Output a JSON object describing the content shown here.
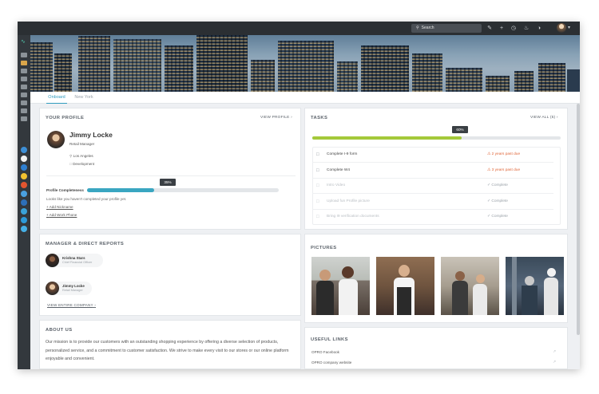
{
  "topbar": {
    "search_placeholder": "Search",
    "icons": [
      "pencil-icon",
      "plus-icon",
      "clock-icon",
      "bell-icon",
      "moon-icon"
    ]
  },
  "tabs": [
    {
      "label": "Onboard",
      "active": true
    },
    {
      "label": "New York",
      "active": false
    }
  ],
  "profile": {
    "section_title": "YOUR PROFILE",
    "view_link": "VIEW PROFILE",
    "name": "Jimmy Locke",
    "role": "Retail Manager",
    "location": "Los Angeles",
    "department": "Development",
    "completeness_label": "Profile Completeness",
    "completeness_value": 35,
    "completeness_text": "35%",
    "hint": "Looks like you haven't completed your profile yet.",
    "add_nickname": "Add Nickname",
    "add_work_phone": "Add Work Phone"
  },
  "reports": {
    "section_title": "MANAGER & DIRECT REPORTS",
    "people": [
      {
        "name": "Krishna Stars",
        "title": "Chief Financial Officer"
      },
      {
        "name": "Jimmy Locke",
        "title": "Retail Manager"
      }
    ],
    "view_link": "VIEW ENTIRE COMPANY"
  },
  "about": {
    "section_title": "ABOUT US",
    "text": "Our mission is to provide our customers with an outstanding shopping experience by offering a diverse selection of products, personalized service, and a commitment to customer satisfaction. We strive to make every visit to our stores or our online platform enjoyable and convenient."
  },
  "tasks": {
    "section_title": "TASKS",
    "view_all": "VIEW ALL (5)",
    "progress_value": 60,
    "progress_text": "60%",
    "items": [
      {
        "label": "Complete I-9 form",
        "status": "2 years past due",
        "state": "overdue"
      },
      {
        "label": "Complete W4",
        "status": "3 years past due",
        "state": "overdue"
      },
      {
        "label": "Intro Video",
        "status": "Complete",
        "state": "complete"
      },
      {
        "label": "Upload fun Profile picture",
        "status": "Complete",
        "state": "complete"
      },
      {
        "label": "Bring I9 verification documents",
        "status": "Complete",
        "state": "complete"
      }
    ],
    "colors": {
      "overdue": "#e0673a",
      "complete": "#9aa1a8",
      "progress": "#a4c93a"
    }
  },
  "pictures": {
    "section_title": "PICTURES"
  },
  "links": {
    "section_title": "USEFUL LINKS",
    "items": [
      {
        "label": "OPRO Facebook"
      },
      {
        "label": "OPRO company website"
      }
    ]
  },
  "colors": {
    "accent": "#2f9bbd",
    "rail": "#33383d",
    "topbar": "#2b2f33"
  }
}
